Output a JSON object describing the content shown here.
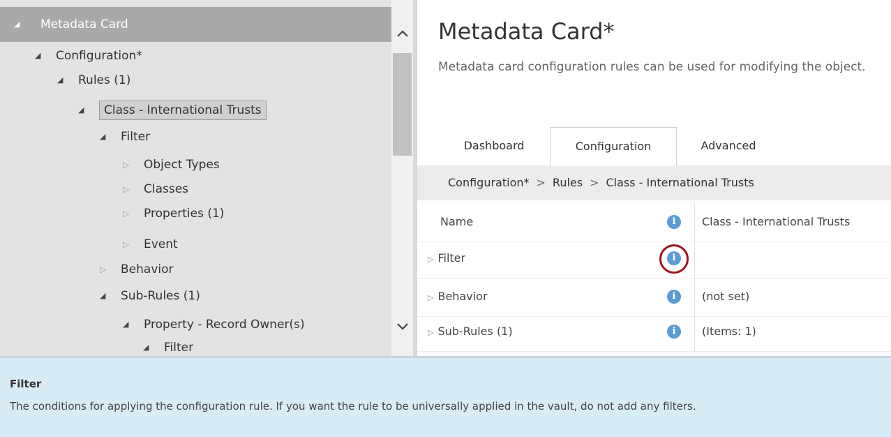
{
  "tree": {
    "root": {
      "label": "Metadata Card",
      "toggle": "◢"
    },
    "items": [
      {
        "label": "Configuration*",
        "toggle": "◢",
        "state": "expanded"
      },
      {
        "label": "Rules (1)",
        "toggle": "◢",
        "state": "expanded"
      },
      {
        "label": "Class - International Trusts",
        "toggle": "◢",
        "state": "expanded",
        "selected": true
      },
      {
        "label": "Filter",
        "toggle": "◢",
        "state": "expanded"
      },
      {
        "label": "Object Types",
        "toggle": "▷",
        "state": "collapsed"
      },
      {
        "label": "Classes",
        "toggle": "▷",
        "state": "collapsed"
      },
      {
        "label": "Properties (1)",
        "toggle": "▷",
        "state": "collapsed"
      },
      {
        "label": "Event",
        "toggle": "▷",
        "state": "collapsed"
      },
      {
        "label": "Behavior",
        "toggle": "▷",
        "state": "collapsed"
      },
      {
        "label": "Sub-Rules (1)",
        "toggle": "◢",
        "state": "expanded"
      },
      {
        "label": "Property - Record Owner(s)",
        "toggle": "◢",
        "state": "expanded"
      },
      {
        "label": "Filter",
        "toggle": "◢",
        "state": "expanded"
      }
    ]
  },
  "page": {
    "title": "Metadata Card*",
    "description": "Metadata card configuration rules can be used for modifying the object."
  },
  "tabs": [
    {
      "label": "Dashboard",
      "active": false
    },
    {
      "label": "Configuration",
      "active": true
    },
    {
      "label": "Advanced",
      "active": false
    }
  ],
  "breadcrumb": [
    "Configuration*",
    "Rules",
    "Class - International Trusts"
  ],
  "breadcrumb_separator": ">",
  "properties": [
    {
      "name": "Name",
      "value": "Class - International Trusts",
      "toggle": ""
    },
    {
      "name": "Filter",
      "value": "",
      "toggle": "▷"
    },
    {
      "name": "Behavior",
      "value": "(not set)",
      "toggle": "▷"
    },
    {
      "name": "Sub-Rules (1)",
      "value": "(Items: 1)",
      "toggle": "▷"
    }
  ],
  "info_icon_glyph": "i",
  "help": {
    "title": "Filter",
    "text": "The conditions for applying the configuration rule. If you want the rule to be universally applied in the vault, do not add any filters."
  },
  "colors": {
    "tree_bg": "#e3e3e3",
    "tree_root_bg": "#a9a9a9",
    "info_icon": "#5b9bd5",
    "highlight_ring": "#a0141e",
    "help_bg": "#d7ecf5"
  }
}
